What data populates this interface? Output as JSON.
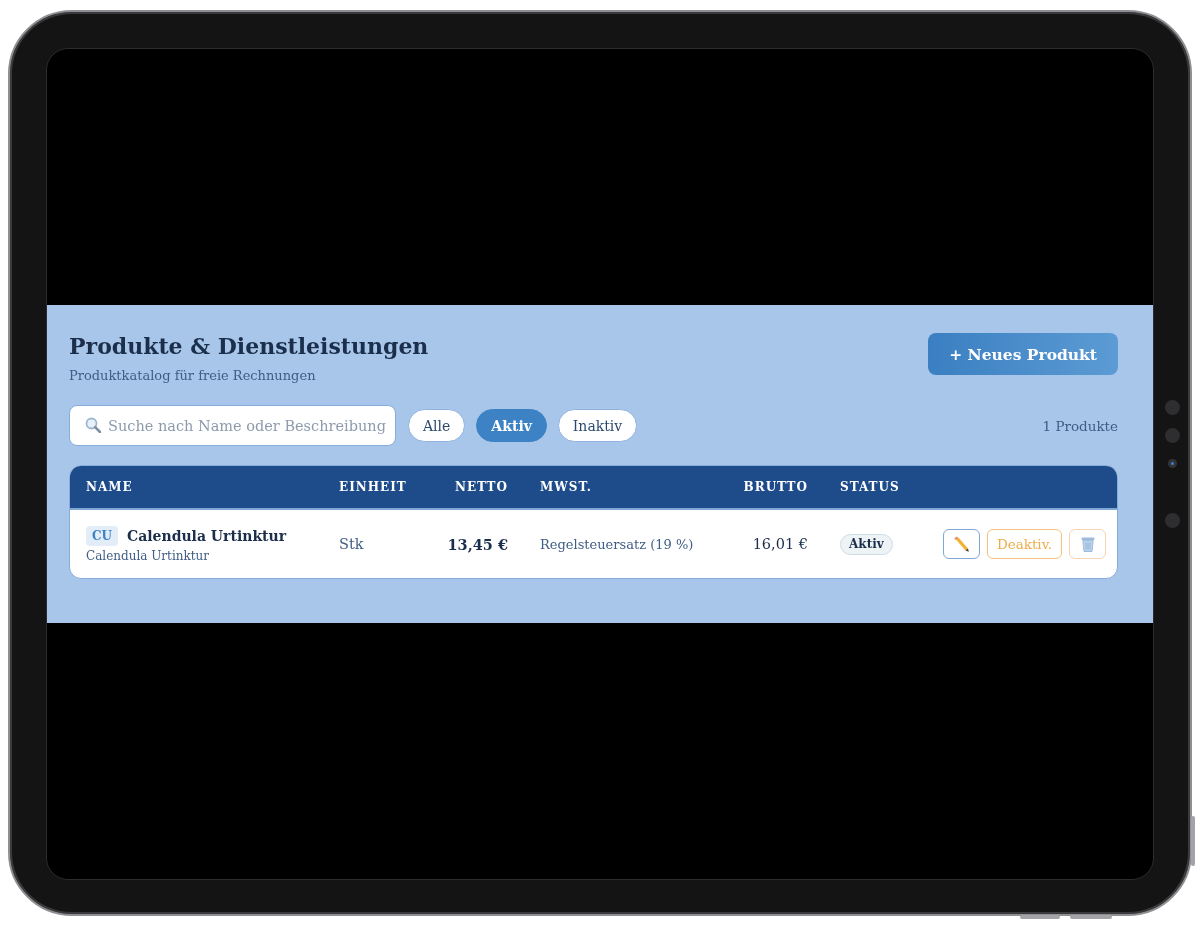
{
  "header": {
    "title": "Produkte & Dienstleistungen",
    "subtitle": "Produktkatalog für freie Rechnungen",
    "new_button": "+ Neues Produkt"
  },
  "search": {
    "placeholder": "Suche nach Name oder Beschreibung"
  },
  "filters": [
    {
      "label": "Alle",
      "selected": false
    },
    {
      "label": "Aktiv",
      "selected": true
    },
    {
      "label": "Inaktiv",
      "selected": false
    }
  ],
  "count": "1 Produkte",
  "table": {
    "columns": [
      "NAME",
      "EINHEIT",
      "NETTO",
      "MWST.",
      "BRUTTO",
      "STATUS"
    ],
    "rows": [
      {
        "code": "CU",
        "name": "Calendula Urtinktur",
        "description": "Calendula Urtinktur",
        "unit": "Stk",
        "net": "13,45 €",
        "vat": "Regelsteuersatz (19 %)",
        "gross": "16,01 €",
        "status": "Aktiv",
        "active": true,
        "toggle_label": "Deaktiv."
      }
    ]
  }
}
